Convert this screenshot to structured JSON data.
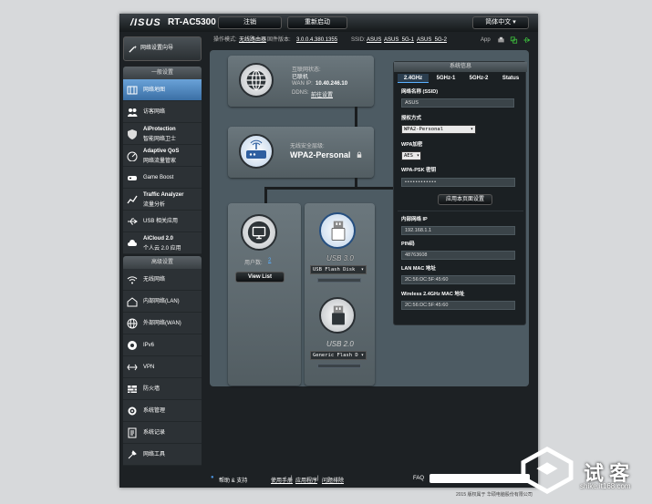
{
  "header": {
    "logo": "/ISUS",
    "model": "RT-AC5300",
    "logout": "注销",
    "reboot": "重新启动",
    "language": "简体中文"
  },
  "status": {
    "mode_label": "操作模式:",
    "mode_value": "无线路由器",
    "fw_label": "固件版本:",
    "fw_value": "3.0.0.4.380.1355",
    "ssid_label": "SSID:",
    "ssid1": "ASUS",
    "ssid2": "ASUS_5G-1",
    "ssid3": "ASUS_5G-2",
    "app": "App"
  },
  "quick_setup": "网络设置向导",
  "nav_general": {
    "header": "一般设置",
    "items": [
      {
        "icon": "map-icon",
        "label": "网络地图",
        "selected": true
      },
      {
        "icon": "users-icon",
        "label": "访客网络"
      },
      {
        "icon": "shield-icon",
        "label": "AiProtection",
        "sub": "智能网络卫士"
      },
      {
        "icon": "qos-icon",
        "label": "Adaptive QoS",
        "sub": "网络流量管家"
      },
      {
        "icon": "gamepad-icon",
        "label": "Game Boost"
      },
      {
        "icon": "chart-icon",
        "label": "Traffic Analyzer",
        "sub": "流量分析"
      },
      {
        "icon": "usb-icon",
        "label": "USB 相关应用"
      },
      {
        "icon": "cloud-icon",
        "label": "AiCloud 2.0",
        "sub": "个人云 2.0 应用"
      }
    ]
  },
  "nav_advanced": {
    "header": "高级设置",
    "items": [
      {
        "icon": "wifi-icon",
        "label": "无线网络"
      },
      {
        "icon": "home-icon",
        "label": "内部网络(LAN)"
      },
      {
        "icon": "globe-icon",
        "label": "外部网络(WAN)"
      },
      {
        "icon": "ipv6-icon",
        "label": "IPv6"
      },
      {
        "icon": "vpn-icon",
        "label": "VPN"
      },
      {
        "icon": "firewall-icon",
        "label": "防火墙"
      },
      {
        "icon": "gear-icon",
        "label": "系统管理"
      },
      {
        "icon": "log-icon",
        "label": "系统记录"
      },
      {
        "icon": "tools-icon",
        "label": "网络工具"
      }
    ]
  },
  "internet": {
    "status_label": "互联网状态:",
    "status_value": "已联机",
    "wan_label": "WAN IP:",
    "wan_ip": "10.40.246.10",
    "ddns_label": "DDNS:",
    "ddns_value": "前往设置"
  },
  "wireless": {
    "security_label": "无线安全层级:",
    "security_value": "WPA2-Personal"
  },
  "clients": {
    "label": "用户数:",
    "count": "2",
    "button": "View List"
  },
  "usb": [
    {
      "label": "USB 3.0",
      "device": "USB Flash Disk"
    },
    {
      "label": "USB 2.0",
      "device": "Generic Flash D"
    }
  ],
  "sysinfo": {
    "title": "系统信息",
    "tabs": [
      "2.4GHz",
      "5GHz-1",
      "5GHz-2",
      "Status"
    ],
    "ssid_label": "网络名称 (SSID)",
    "ssid_value": "ASUS",
    "auth_label": "授权方式",
    "auth_value": "WPA2-Personal",
    "enc_label": "WPA加密",
    "enc_value": "AES",
    "psk_label": "WPA-PSK 密钥",
    "psk_value": "••••••••••••",
    "apply": "应用本页面设置",
    "lan_ip_label": "内部网络 IP",
    "lan_ip": "192.168.1.1",
    "pin_label": "PIN码",
    "pin": "48763608",
    "lan_mac_label": "LAN MAC 地址",
    "lan_mac": "2C:56:DC:5F:45:60",
    "wl_mac_label": "Wireless 2.4GHz MAC 地址",
    "wl_mac": "2C:56:DC:5F:45:60"
  },
  "footer": {
    "help": "帮助 & 支持",
    "manual": "使用手册",
    "utility": "应用程序",
    "faq_links": "问题排除",
    "faq": "FAQ",
    "copyright": "2015 版权属于 华硕电脑股份有限公司"
  },
  "watermark": {
    "name": "试 客",
    "url": "shike.it168.com"
  }
}
